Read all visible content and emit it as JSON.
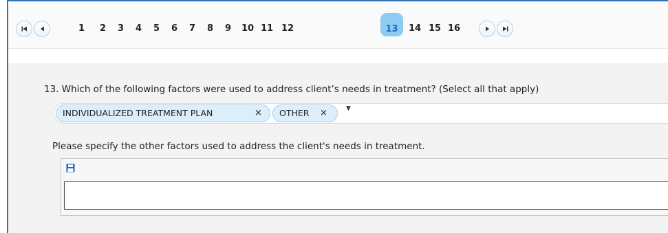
{
  "pager": {
    "first_icon": "first-page-icon",
    "prev_icon": "previous-page-icon",
    "next_icon": "next-page-icon",
    "last_icon": "last-page-icon",
    "pages": [
      "1",
      "2",
      "3",
      "4",
      "5",
      "6",
      "7",
      "8",
      "9",
      "10",
      "11",
      "12",
      "13",
      "14",
      "15",
      "16"
    ],
    "current_page": "13",
    "current_color": "#8dcbf0"
  },
  "question": {
    "text": "13. Which of the following factors were used to address client’s needs in treatment? (Select all that apply)",
    "selected": [
      {
        "label": "INDIVIDUALIZED TREATMENT PLAN",
        "remove": "×"
      },
      {
        "label": "OTHER",
        "remove": "×"
      }
    ],
    "dropdown_icon": "dropdown-caret-icon"
  },
  "other": {
    "label": "Please specify the other factors used to address the client's needs in treatment.",
    "save_icon": "save-icon",
    "value": ""
  }
}
